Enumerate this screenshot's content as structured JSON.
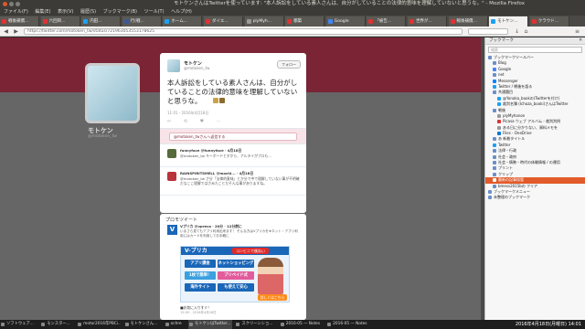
{
  "window": {
    "title": "モトケンさんはTwitterを使っています: \"本人訴訟をしている素人さんは、自分がしていることの法律的意味を理解していないと思うな。\" - Mozilla Firefox"
  },
  "menu": [
    "ファイル(F)",
    "編集(E)",
    "表示(V)",
    "履歴(S)",
    "ブックマーク(B)",
    "ツール(T)",
    "ヘルプ(H)"
  ],
  "tabs": [
    {
      "label": "戦後補償..."
    },
    {
      "label": "六回目..."
    },
    {
      "label": "内田..."
    },
    {
      "label": "行(戦..."
    },
    {
      "label": "ホーム..."
    },
    {
      "label": "ダイエ..."
    },
    {
      "label": "plyMyh..."
    },
    {
      "label": "都築"
    },
    {
      "label": "Google"
    },
    {
      "label": "「被告..."
    },
    {
      "label": "世界が..."
    },
    {
      "label": "戦後補償..."
    },
    {
      "label": "2016-03..."
    },
    {
      "label": "(-ページ..."
    },
    {
      "label": "モトケン...",
      "active": true
    },
    {
      "label": "クラウド..."
    },
    {
      "label": "2016-04..."
    },
    {
      "label": "ツイート"
    }
  ],
  "nav": {
    "url": "https://twitter.com/motoken_tw/status/721963053553178625"
  },
  "profile": {
    "name": "モトケン",
    "handle": "@motoken_tw"
  },
  "tweet": {
    "name": "モトケン",
    "handle": "@motoken_tw",
    "follow": "フォロー",
    "text": "本人訴訟をしている素人さんは、自分がしていることの法律的意味を理解していないと思うな。",
    "retweets": "1",
    "likes": "3",
    "timestamp": "11:01 - 2016年4月18日",
    "actions": [
      "↩",
      "⟲",
      "♥",
      "⋯"
    ],
    "reply_placeholder": "@motoken_twさんへ返信する"
  },
  "replies": [
    {
      "head": "funnyface @funnyface · 4月18日",
      "body": "@motoken_tw キーボードとすから、アルタイがプロも...",
      "color": "#556b3a"
    },
    {
      "head": "RAINSPIRITSMELL @mochi... · 4月18日",
      "body": "@motoken_tw さ分「法律的意味」とか分で中で理解していない事が不明確だなここ理解ではさみたことだそんな事がありますね。",
      "color": "#b8333a"
    }
  ],
  "promo": {
    "title": "プロモツイート",
    "account_head": "Vプリカ @vpreca · 20分 · 12分前に",
    "body": "いまさら見てもアプリ利用出来ます！ そんな方はVプリカを★ネット・アプリ利用にはカードを利用してお手軽に",
    "avatar": "V",
    "ad_brand": "V-プリカ",
    "ad_badge": "コンビニで後払い",
    "ad_cells": [
      "アプリ課金",
      "ネットショッピング",
      "1枚で簡単！",
      "プリペイド式",
      "海外サイト",
      "も使えて安心"
    ],
    "ad_cta": "詳しくはこちら",
    "link": "■お気に入りすぐ！",
    "stamp": "15:00 - 2016年4月18日"
  },
  "sidebar": {
    "title": "ブックマーク",
    "search_placeholder": "検索",
    "items": [
      {
        "label": "ブックマークツールバー",
        "color": "#6a8fc9"
      },
      {
        "label": "Blog",
        "color": "#6a8fc9"
      },
      {
        "label": "Google",
        "color": "#4285f4"
      },
      {
        "label": "net",
        "color": "#6a8fc9"
      },
      {
        "label": "Messenger",
        "color": "#0084ff"
      },
      {
        "label": "Twitter / 戦後を語る",
        "color": "#1da1f2"
      },
      {
        "label": "共通題目",
        "color": "#6a8fc9"
      },
      {
        "label": "@Yonaka_bookの(Twitterを付け)",
        "color": "#1da1f2"
      },
      {
        "label": "裁判名簿 (Ichoza_booki)さんはTwitter",
        "color": "#1da1f2"
      },
      {
        "label": "戦後",
        "color": "#6a8fc9"
      },
      {
        "label": "plyMyhanon",
        "color": "#999"
      },
      {
        "label": "Picasa ウェブ アルバム - 裁判判例",
        "color": "#d33"
      },
      {
        "label": "ある日に分かりない、資料メモを",
        "color": "#999"
      },
      {
        "label": "Files - OneDrive",
        "color": "#0078d7"
      },
      {
        "label": "あ 新着タイトル",
        "color": "#6a8fc9"
      },
      {
        "label": "Twitter",
        "color": "#1da1f2"
      },
      {
        "label": "法律・行政",
        "color": "#6a8fc9"
      },
      {
        "label": "社会・政府",
        "color": "#6a8fc9"
      },
      {
        "label": "社会・情勢・時代の体験情報 / の運用",
        "color": "#6a8fc9"
      },
      {
        "label": "プリント",
        "color": "#6a8fc9"
      },
      {
        "label": "クリップ",
        "color": "#6a8fc9"
      },
      {
        "label": "最新の記事保管",
        "color": "#fff",
        "selected": true
      },
      {
        "label": "bmess2015bの フリア",
        "color": "#6a8fc9"
      },
      {
        "label": "ブックマークメニュー",
        "color": "#6a8fc9"
      },
      {
        "label": "未整理のブックマーク",
        "color": "#6a8fc9"
      }
    ]
  },
  "taskbar": {
    "tasks": [
      {
        "label": "ソフトウェア..."
      },
      {
        "label": "モンスター..."
      },
      {
        "label": "motor2016年PBCi..."
      },
      {
        "label": "モトケンさん..."
      },
      {
        "label": "ochre"
      },
      {
        "label": "モトケンはTwitter...",
        "active": true
      },
      {
        "label": "スクリーンショ..."
      },
      {
        "label": "2016-05 — Notes"
      },
      {
        "label": "2016-05 — Notes"
      },
      {
        "label": "2016-05 — Nike"
      }
    ],
    "clock": "2016年4月18日(月曜日) 14:01"
  }
}
